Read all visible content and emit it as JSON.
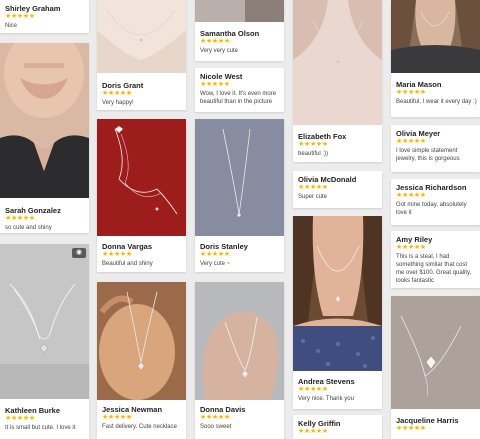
{
  "accent": "#f5b700",
  "star_rating": 5,
  "stars_text": "★★★★★",
  "reviews": {
    "shirley": {
      "name": "Shirley Graham",
      "text": "Nice"
    },
    "sarah": {
      "name": "Sarah Gonzalez",
      "text": "so cute and shiny"
    },
    "kathleen": {
      "name": "Kathleen Burke",
      "text": "It is small but cute. I love it"
    },
    "doris_grant": {
      "name": "Doris Grant",
      "text": "Very happy!"
    },
    "donna_vargas": {
      "name": "Donna Vargas",
      "text": "Beautiful and shiny"
    },
    "jessica_newman": {
      "name": "Jessica Newman",
      "text": "Fast delivery. Cute necklace"
    },
    "samantha": {
      "name": "Samantha Olson",
      "text": "Very very cute"
    },
    "nicole": {
      "name": "Nicole West",
      "text": "Wow, I love it. It's even more beautiful than in the picture"
    },
    "doris_stanley": {
      "name": "Doris Stanley",
      "text": "Very cute ~"
    },
    "donna_davis": {
      "name": "Donna Davis",
      "text": "Sooo sweet"
    },
    "elizabeth": {
      "name": "Elizabeth Fox",
      "text": "beautiful :))"
    },
    "olivia_mcdonald": {
      "name": "Olivia McDonald",
      "text": "Super cute"
    },
    "andrea": {
      "name": "Andrea Stevens",
      "text": "Very nice. Thank you"
    },
    "kelly": {
      "name": "Kelly Griffin",
      "text": ""
    },
    "maria": {
      "name": "Maria Mason",
      "text": "Beautiful, I wear it every day :)"
    },
    "olivia_meyer": {
      "name": "Olivia Meyer",
      "text": "I love simple statement jewelry, this is gorgeous"
    },
    "jessica_richardson": {
      "name": "Jessica Richardson",
      "text": "Got mine today, absolutely love it"
    },
    "amy": {
      "name": "Amy Riley",
      "text": "This is a steal, I had something similar that cost me over $100. Great quality, looks fantastic"
    },
    "jacqueline": {
      "name": "Jacqueline Harris",
      "text": ""
    }
  }
}
